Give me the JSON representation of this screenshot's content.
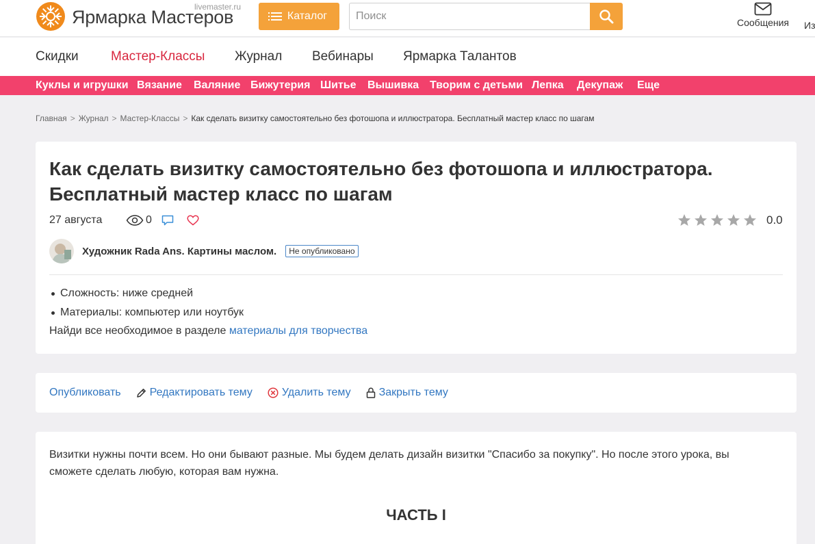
{
  "header": {
    "logo_text": "Ярмарка Мастеров",
    "logo_domain": "livemaster.ru",
    "catalog_label": "Каталог",
    "search_placeholder": "Поиск",
    "messages_label": "Сообщения",
    "favorites_label_partial": "Из",
    "brand_color": "#f4a23a"
  },
  "subnav": {
    "items": [
      "Скидки",
      "Мастер-Классы",
      "Журнал",
      "Вебинары",
      "Ярмарка Талантов"
    ],
    "active": "Мастер-Классы"
  },
  "categories": {
    "items": [
      "Куклы и игрушки",
      "Вязание",
      "Валяние",
      "Бижутерия",
      "Шитье",
      "Вышивка",
      "Творим с детьми",
      "Лепка",
      "Декупаж",
      "Еще"
    ],
    "bar_color": "#f2416c"
  },
  "breadcrumb": {
    "items": [
      "Главная",
      "Журнал",
      "Мастер-Классы"
    ],
    "current": "Как сделать визитку самостоятельно без фотошопа и иллюстратора. Бесплатный мастер класс по шагам"
  },
  "article": {
    "title_line1": "Как сделать визитку самостоятельно без фотошопа и иллюстратора.",
    "title_line2": "Бесплатный мастер класс по шагам",
    "date": "27 августа",
    "views": "0",
    "rating": "0.0",
    "author": "Художник Rada Ans. Картины маслом.",
    "status_badge": "Не опубликовано",
    "specs": [
      "Сложность: ниже средней",
      "Материалы: компьютер или ноутбук"
    ],
    "find_text": "Найди все необходимое в разделе ",
    "find_link": "материалы для творчества"
  },
  "actions": {
    "publish": "Опубликовать",
    "edit": "Редактировать тему",
    "delete": "Удалить тему",
    "close": "Закрыть тему"
  },
  "content": {
    "intro": "Визитки нужны почти всем. Но они бывают разные. Мы будем делать дизайн визитки \"Спасибо за покупку\". Но после этого урока, вы сможете сделать любую, которая вам нужна.",
    "part_heading": "ЧАСТЬ I"
  }
}
